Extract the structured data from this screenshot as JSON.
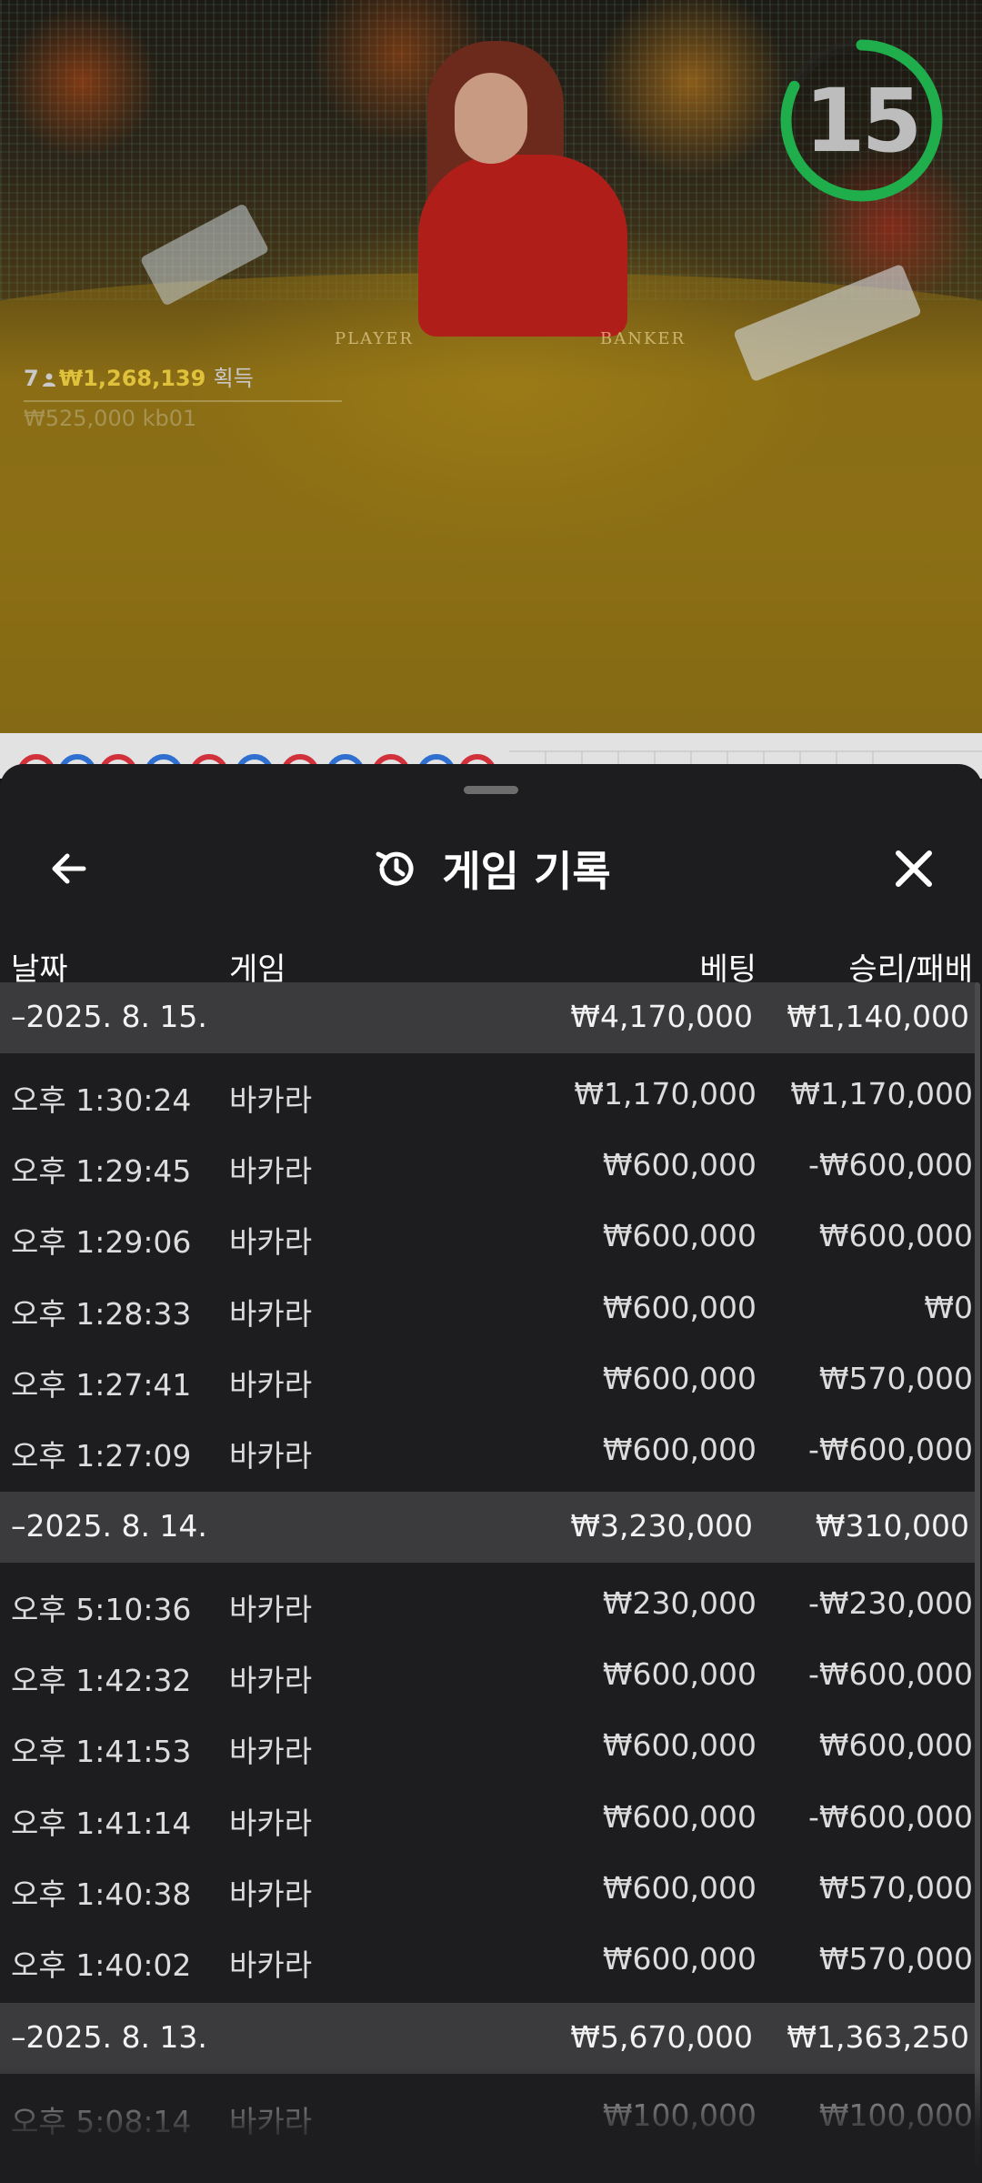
{
  "video": {
    "timer_value": "15",
    "winner": {
      "count": "7",
      "amount": "₩1,268,139",
      "suffix": "획득",
      "sub": "₩525,000  kb01"
    },
    "table_labels": [
      "PLAYER",
      "BANKER"
    ]
  },
  "header": {
    "title": "게임 기록"
  },
  "columns": {
    "date": "날짜",
    "game": "게임",
    "bet": "베팅",
    "result": "승리/패배"
  },
  "days": [
    {
      "date": "–2025. 8. 15.",
      "bet": "₩4,170,000",
      "result": "₩1,140,000",
      "rows": [
        {
          "time": "오후 1:30:24",
          "game": "바카라",
          "bet": "₩1,170,000",
          "result": "₩1,170,000"
        },
        {
          "time": "오후 1:29:45",
          "game": "바카라",
          "bet": "₩600,000",
          "result": "-₩600,000"
        },
        {
          "time": "오후 1:29:06",
          "game": "바카라",
          "bet": "₩600,000",
          "result": "₩600,000"
        },
        {
          "time": "오후 1:28:33",
          "game": "바카라",
          "bet": "₩600,000",
          "result": "₩0"
        },
        {
          "time": "오후 1:27:41",
          "game": "바카라",
          "bet": "₩600,000",
          "result": "₩570,000"
        },
        {
          "time": "오후 1:27:09",
          "game": "바카라",
          "bet": "₩600,000",
          "result": "-₩600,000"
        }
      ]
    },
    {
      "date": "–2025. 8. 14.",
      "bet": "₩3,230,000",
      "result": "₩310,000",
      "rows": [
        {
          "time": "오후 5:10:36",
          "game": "바카라",
          "bet": "₩230,000",
          "result": "-₩230,000"
        },
        {
          "time": "오후 1:42:32",
          "game": "바카라",
          "bet": "₩600,000",
          "result": "-₩600,000"
        },
        {
          "time": "오후 1:41:53",
          "game": "바카라",
          "bet": "₩600,000",
          "result": "₩600,000"
        },
        {
          "time": "오후 1:41:14",
          "game": "바카라",
          "bet": "₩600,000",
          "result": "-₩600,000"
        },
        {
          "time": "오후 1:40:38",
          "game": "바카라",
          "bet": "₩600,000",
          "result": "₩570,000"
        },
        {
          "time": "오후 1:40:02",
          "game": "바카라",
          "bet": "₩600,000",
          "result": "₩570,000"
        }
      ]
    },
    {
      "date": "–2025. 8. 13.",
      "bet": "₩5,670,000",
      "result": "₩1,363,250",
      "rows": [
        {
          "time": "오후 5:08:14",
          "game": "바카라",
          "bet": "₩100,000",
          "result": "₩100,000"
        }
      ]
    }
  ],
  "colors": {
    "sheet_bg": "#1d1d1f",
    "day_row_bg": "#3b3b3d",
    "timer_ring": "#1fae4b",
    "winner_amount": "#e0c13b",
    "player_road": "#2f6fd0",
    "banker_road": "#d0313a"
  }
}
